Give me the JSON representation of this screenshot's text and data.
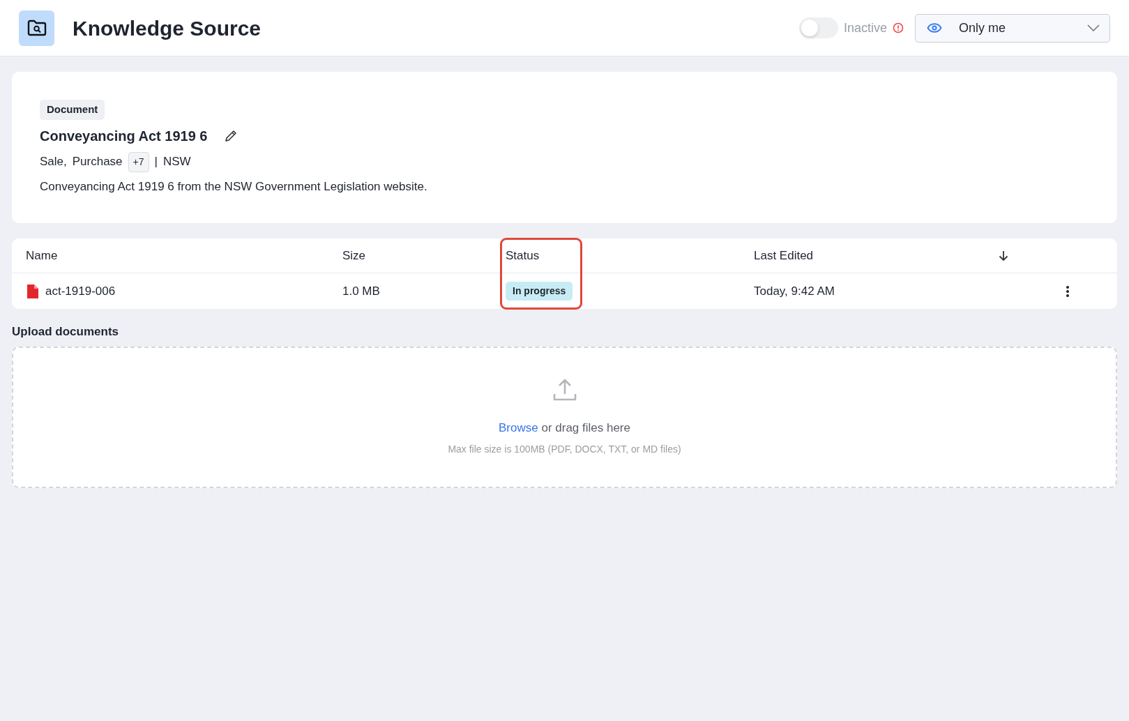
{
  "header": {
    "title": "Knowledge Source",
    "active_toggle": {
      "on": false,
      "label": "Inactive"
    },
    "visibility": {
      "value": "Only me"
    }
  },
  "source": {
    "type_badge": "Document",
    "title": "Conveyancing Act 1919 6",
    "tags": [
      "Sale,",
      "Purchase"
    ],
    "more_tags": "+7",
    "separator": "|",
    "region": "NSW",
    "description": "Conveyancing Act 1919 6 from the NSW Government Legislation website."
  },
  "table": {
    "columns": [
      {
        "label": "Name",
        "highlighted": false
      },
      {
        "label": "Size",
        "highlighted": false
      },
      {
        "label": "Status",
        "highlighted": true
      },
      {
        "label": "Last Edited",
        "highlighted": false
      }
    ],
    "rows": [
      {
        "name": "act-1919-006",
        "size": "1.0 MB",
        "status": "In progress",
        "last_edited": "Today, 9:42 AM"
      }
    ]
  },
  "upload": {
    "label": "Upload documents",
    "browse": "Browse",
    "prompt": "or drag files here",
    "hint": "Max file size is 100MB (PDF, DOCX, TXT, or MD files)"
  }
}
